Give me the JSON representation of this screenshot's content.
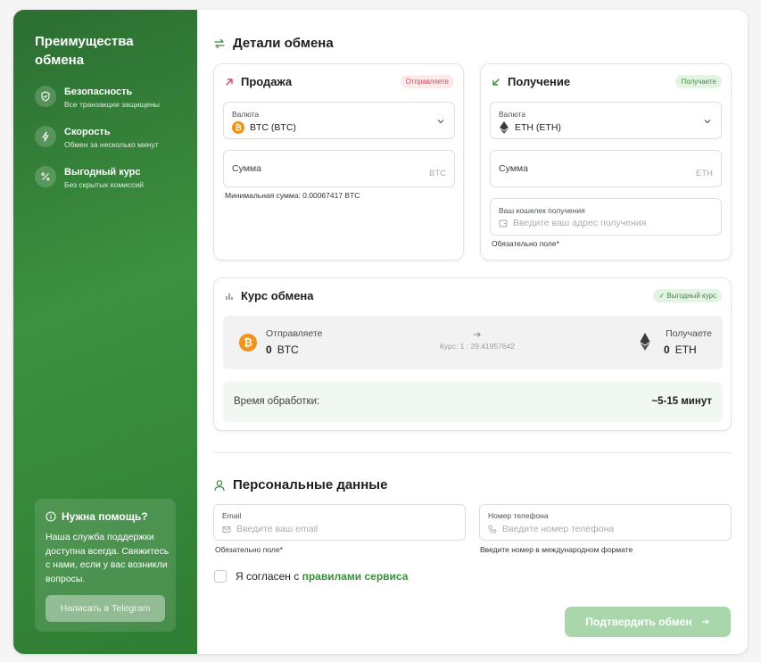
{
  "sidebar": {
    "title": "Преимущества обмена",
    "features": [
      {
        "icon": "shield-icon",
        "title": "Безопасность",
        "desc": "Все транзакции защищены"
      },
      {
        "icon": "lightning-icon",
        "title": "Скорость",
        "desc": "Обмен за несколько минут"
      },
      {
        "icon": "percent-icon",
        "title": "Выгодный курс",
        "desc": "Без скрытых комиссий"
      }
    ],
    "help": {
      "title": "Нужна помощь?",
      "text": "Наша служба поддержки доступна всегда. Свяжитесь с нами, если у вас возникли вопросы.",
      "button": "Написать в Telegram"
    }
  },
  "exchange": {
    "title": "Детали обмена",
    "sell": {
      "title": "Продажа",
      "badge": "Отправляете",
      "currency_label": "Валюта",
      "currency_value": "BTC (BTC)",
      "amount_label": "Сумма",
      "amount_unit": "BTC",
      "min_note": "Минимальная сумма: 0.00067417 BTC"
    },
    "receive": {
      "title": "Получение",
      "badge": "Получаете",
      "currency_label": "Валюта",
      "currency_value": "ETH (ETH)",
      "amount_label": "Сумма",
      "amount_unit": "ETH",
      "wallet_label": "Ваш кошелек получения",
      "wallet_placeholder": "Введите ваш адрес получения",
      "required_note": "Обязательно поле*"
    }
  },
  "rate": {
    "title": "Курс обмена",
    "badge": "✓ Выгодный курс",
    "send_label": "Отправляете",
    "send_amount": "0",
    "send_unit": "BTC",
    "receive_label": "Получаете",
    "receive_amount": "0",
    "receive_unit": "ETH",
    "rate_text": "Курс: 1 : 29.41957642",
    "time_label": "Время обработки:",
    "time_value": "~5-15 минут"
  },
  "personal": {
    "title": "Персональные данные",
    "email_label": "Email",
    "email_placeholder": "Введите ваш email",
    "email_note": "Обязательно поле*",
    "phone_label": "Номер телефона",
    "phone_placeholder": "Введите номер телефона",
    "phone_note": "Введите номер в международном формате",
    "agree_prefix": "Я согласен с ",
    "agree_link": "правилами сервиса",
    "submit": "Подтвердить обмен"
  },
  "colors": {
    "accent": "#3a8e3d",
    "sidebar": "#2f7d34",
    "btc": "#f1921b",
    "sell_badge": "#d84a5a"
  }
}
